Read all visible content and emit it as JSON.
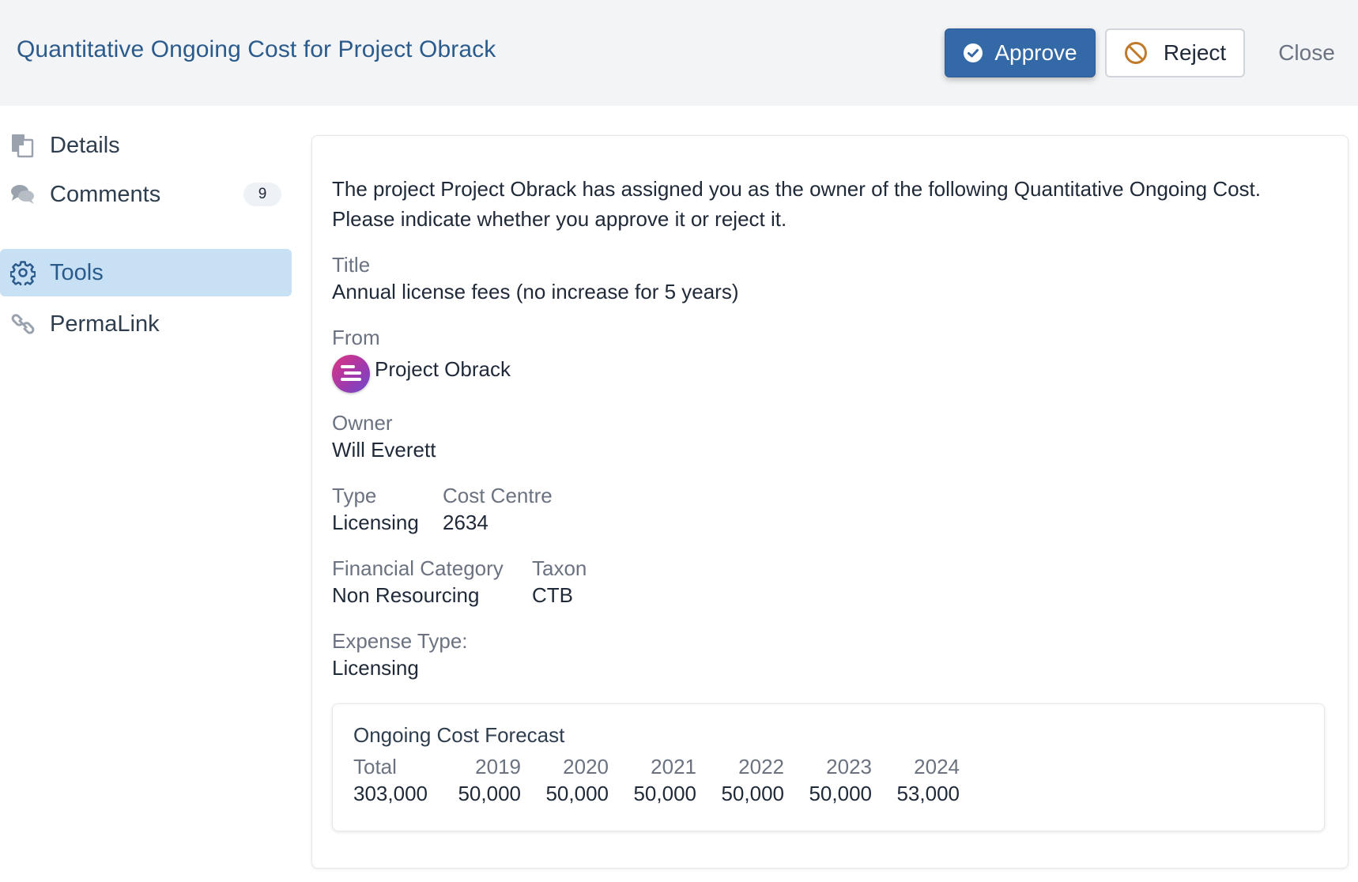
{
  "header": {
    "title": "Quantitative Ongoing Cost for Project Obrack",
    "approve_label": "Approve",
    "reject_label": "Reject",
    "close_label": "Close"
  },
  "sidebar": {
    "items": [
      {
        "label": "Details",
        "icon": "document-icon"
      },
      {
        "label": "Comments",
        "icon": "comments-icon",
        "badge": "9"
      },
      {
        "label": "Tools",
        "icon": "gear-icon",
        "active": true
      },
      {
        "label": "PermaLink",
        "icon": "link-icon"
      }
    ]
  },
  "main": {
    "intro": "The project Project Obrack has assigned you as the owner of the following Quantitative Ongoing Cost. Please indicate whether you approve it or reject it.",
    "fields": {
      "title_label": "Title",
      "title_value": "Annual license fees (no increase for 5 years)",
      "from_label": "From",
      "from_value": "Project Obrack",
      "owner_label": "Owner",
      "owner_value": "Will Everett",
      "type_label": "Type",
      "type_value": "Licensing",
      "cost_centre_label": "Cost Centre",
      "cost_centre_value": "2634",
      "financial_category_label": "Financial Category",
      "financial_category_value": "Non Resourcing",
      "taxon_label": "Taxon",
      "taxon_value": "CTB",
      "expense_type_label": "Expense Type:",
      "expense_type_value": "Licensing"
    },
    "forecast": {
      "title": "Ongoing Cost Forecast",
      "columns": [
        {
          "header": "Total",
          "value": "303,000"
        },
        {
          "header": "2019",
          "value": "50,000"
        },
        {
          "header": "2020",
          "value": "50,000"
        },
        {
          "header": "2021",
          "value": "50,000"
        },
        {
          "header": "2022",
          "value": "50,000"
        },
        {
          "header": "2023",
          "value": "50,000"
        },
        {
          "header": "2024",
          "value": "53,000"
        }
      ]
    }
  },
  "colors": {
    "accent": "#3469a8",
    "title": "#2b5b8c",
    "active_bg": "#c7e0f4",
    "reject_icon": "#c07a2a"
  }
}
